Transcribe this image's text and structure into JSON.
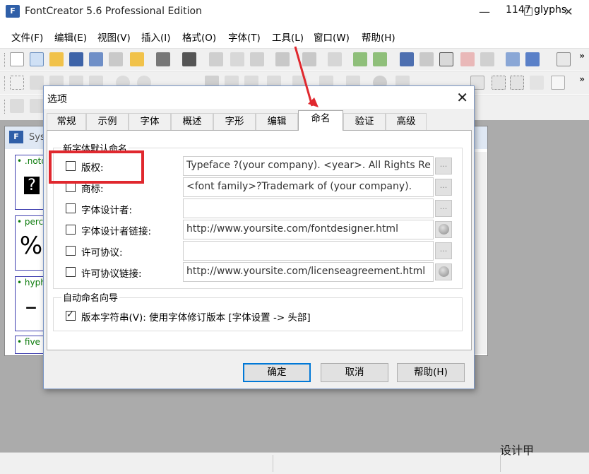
{
  "app": {
    "title": "FontCreator 5.6 Professional Edition",
    "logo_text": "F",
    "window_controls": {
      "minimize": "—",
      "maximize": "☐",
      "close": "✕"
    }
  },
  "menubar": {
    "items": [
      {
        "label": "文件(F)"
      },
      {
        "label": "编辑(E)"
      },
      {
        "label": "视图(V)"
      },
      {
        "label": "插入(I)"
      },
      {
        "label": "格式(O)"
      },
      {
        "label": "字体(T)"
      },
      {
        "label": "工具(L)"
      },
      {
        "label": "窗口(W)"
      },
      {
        "label": "帮助(H)"
      }
    ]
  },
  "toolbar": {
    "overflow": "»"
  },
  "child_window": {
    "title": "Sys",
    "glyphs": [
      {
        "name": "• .notd",
        "char": "?"
      },
      {
        "name": "• perc",
        "char": "%"
      },
      {
        "name": "• hyph",
        "char": "–"
      },
      {
        "name": "• five",
        "char": ""
      }
    ]
  },
  "dialog": {
    "title": "选项",
    "close": "✕",
    "tabs": [
      {
        "label": "常规"
      },
      {
        "label": "示例"
      },
      {
        "label": "字体"
      },
      {
        "label": "概述"
      },
      {
        "label": "字形"
      },
      {
        "label": "编辑"
      },
      {
        "label": "命名",
        "active": true
      },
      {
        "label": "验证"
      },
      {
        "label": "高级"
      }
    ],
    "naming_group": {
      "label": "新字体默认命名",
      "rows": [
        {
          "label": "版权:",
          "value": "Typeface ?(your company). <year>. All Rights Re",
          "button": "..."
        },
        {
          "label": "商标:",
          "value": "<font family>?Trademark of (your company).",
          "button": "..."
        },
        {
          "label": "字体设计者:",
          "value": "",
          "button": "..."
        },
        {
          "label": "字体设计者链接:",
          "value": "http://www.yoursite.com/fontdesigner.html",
          "button": ""
        },
        {
          "label": "许可协议:",
          "value": "",
          "button": "..."
        },
        {
          "label": "许可协议链接:",
          "value": "http://www.yoursite.com/licenseagreement.html",
          "button": ""
        }
      ]
    },
    "auto_group": {
      "label": "自动命名向导",
      "checkbox_label": "版本字符串(V): 使用字体修订版本 [字体设置 -> 头部]",
      "checked": true
    },
    "buttons": {
      "ok": "确定",
      "cancel": "取消",
      "help": "帮助(H)"
    }
  },
  "statusbar": {
    "glyph_count": "1147 glyphs"
  },
  "watermark": "设计甲",
  "colors": {
    "highlight": "#e0282e",
    "accent": "#0078d7"
  }
}
